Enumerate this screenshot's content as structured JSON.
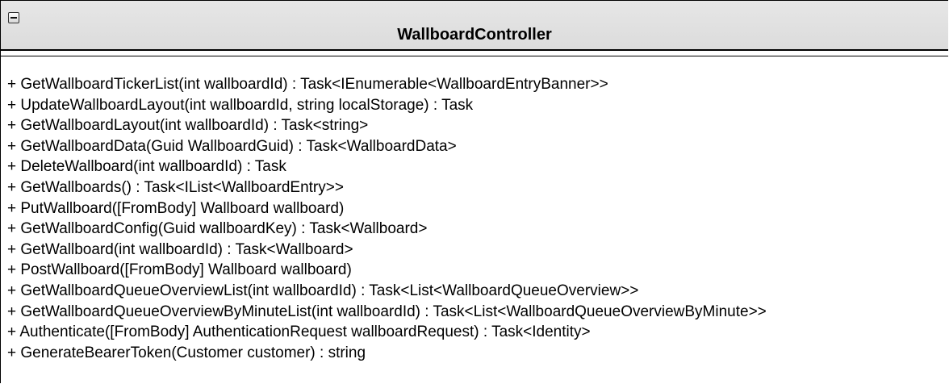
{
  "class": {
    "name": "WallboardController",
    "methods": [
      "+ GetWallboardTickerList(int wallboardId) : Task<IEnumerable<WallboardEntryBanner>>",
      "+ UpdateWallboardLayout(int wallboardId, string localStorage) : Task",
      "+ GetWallboardLayout(int wallboardId) : Task<string>",
      "+ GetWallboardData(Guid WallboardGuid) : Task<WallboardData>",
      "+ DeleteWallboard(int wallboardId) : Task",
      "+ GetWallboards() : Task<IList<WallboardEntry>>",
      "+ PutWallboard([FromBody] Wallboard wallboard)",
      "+ GetWallboardConfig(Guid wallboardKey) : Task<Wallboard>",
      "+ GetWallboard(int wallboardId) : Task<Wallboard>",
      "+ PostWallboard([FromBody] Wallboard wallboard)",
      "+ GetWallboardQueueOverviewList(int wallboardId) : Task<List<WallboardQueueOverview>>",
      "+ GetWallboardQueueOverviewByMinuteList(int wallboardId) : Task<List<WallboardQueueOverviewByMinute>>",
      "+ Authenticate([FromBody] AuthenticationRequest wallboardRequest) : Task<Identity>",
      "+ GenerateBearerToken(Customer customer) : string"
    ]
  },
  "icons": {
    "collapse": "collapse-minus-icon"
  }
}
